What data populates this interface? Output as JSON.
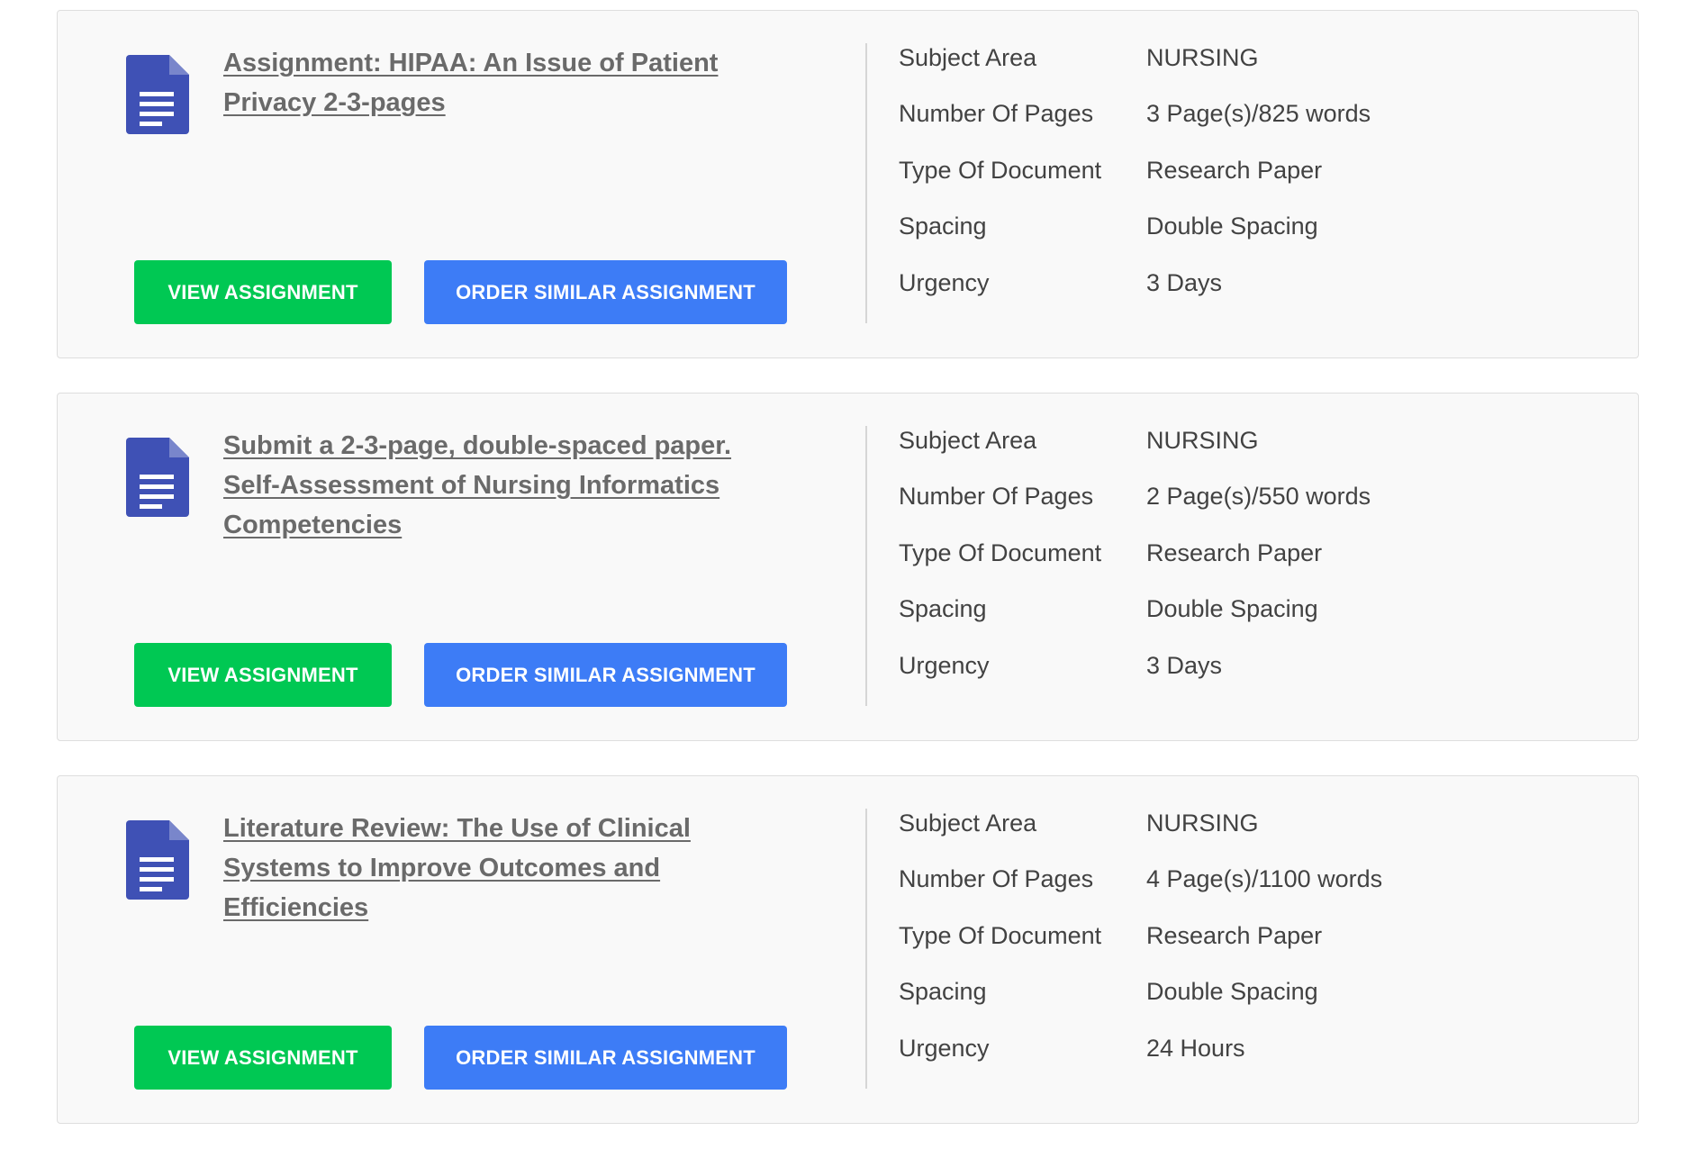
{
  "assignments": [
    {
      "title": "Assignment: HIPAA: An Issue of Patient Privacy 2-3-pages",
      "view_label": "VIEW ASSIGNMENT",
      "order_label": "ORDER SIMILAR ASSIGNMENT",
      "details": [
        {
          "label": "Subject Area",
          "value": "NURSING"
        },
        {
          "label": "Number Of Pages",
          "value": "3 Page(s)/825 words"
        },
        {
          "label": "Type Of Document",
          "value": "Research Paper"
        },
        {
          "label": "Spacing",
          "value": "Double Spacing"
        },
        {
          "label": "Urgency",
          "value": "3 Days"
        }
      ]
    },
    {
      "title": "Submit a 2-3-page, double-spaced paper. Self-Assessment of Nursing Informatics Competencies",
      "view_label": "VIEW ASSIGNMENT",
      "order_label": "ORDER SIMILAR ASSIGNMENT",
      "details": [
        {
          "label": "Subject Area",
          "value": "NURSING"
        },
        {
          "label": "Number Of Pages",
          "value": "2 Page(s)/550 words"
        },
        {
          "label": "Type Of Document",
          "value": "Research Paper"
        },
        {
          "label": "Spacing",
          "value": "Double Spacing"
        },
        {
          "label": "Urgency",
          "value": "3 Days"
        }
      ]
    },
    {
      "title": "Literature Review: The Use of Clinical Systems to Improve Outcomes and Efficiencies",
      "view_label": "VIEW ASSIGNMENT",
      "order_label": "ORDER SIMILAR ASSIGNMENT",
      "details": [
        {
          "label": "Subject Area",
          "value": "NURSING"
        },
        {
          "label": "Number Of Pages",
          "value": "4 Page(s)/1100 words"
        },
        {
          "label": "Type Of Document",
          "value": "Research Paper"
        },
        {
          "label": "Spacing",
          "value": "Double Spacing"
        },
        {
          "label": "Urgency",
          "value": "24 Hours"
        }
      ]
    }
  ],
  "icons": {
    "document": "document-icon"
  },
  "colors": {
    "view_button": "#00c853",
    "order_button": "#3d7cf6",
    "document_icon": "#3f51b5",
    "document_fold": "#7986cb",
    "title_link": "#6a6a6a",
    "card_background": "#f9f9f9"
  }
}
